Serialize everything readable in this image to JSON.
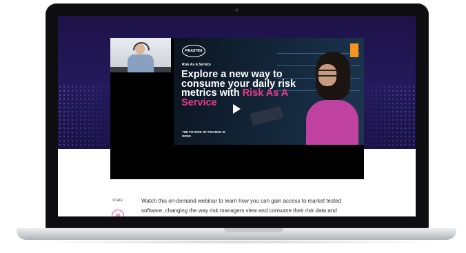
{
  "hero": {
    "background_color": "#1d1248"
  },
  "video": {
    "logo_text": "FINASTRA",
    "kicker": "Risk As A Service",
    "headline_main": "Explore a new way to consume your daily risk metrics with",
    "headline_highlight": "Risk As A Service",
    "tagline": "THE FUTURE OF FINANCE IS OPEN",
    "play_icon": "play-icon",
    "accent_color": "#e63c8c",
    "brand_tab_color": "#f7941d"
  },
  "content": {
    "share_label": "share",
    "share_icon": "linkedin-icon",
    "share_icon_text": "in",
    "description": "Watch this on-demand webinar to learn how you can gain access to market tested software, changing the way risk managers view and consume their risk data and analytics."
  }
}
